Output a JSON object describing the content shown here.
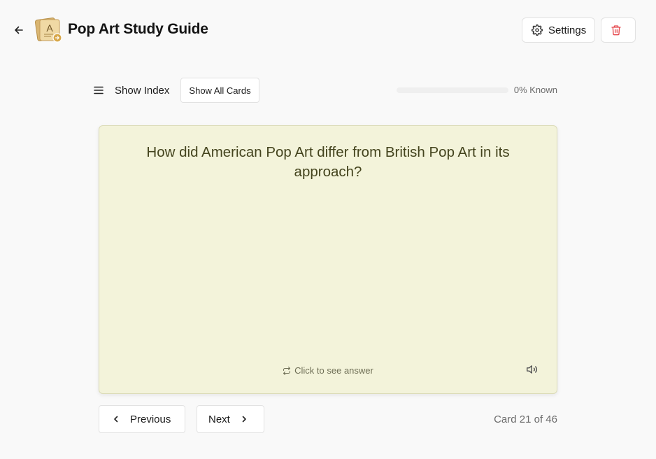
{
  "header": {
    "title": "Pop Art Study Guide",
    "settings_label": "Settings",
    "logo_letter": "A"
  },
  "toolbar": {
    "index_label": "Show Index",
    "show_all_label": "Show All Cards",
    "known_percent": 0,
    "known_label": "0% Known"
  },
  "card": {
    "question": "How did American Pop Art differ from British Pop Art in its approach?",
    "flip_hint": "Click to see answer"
  },
  "navigation": {
    "previous_label": "Previous",
    "next_label": "Next",
    "counter": "Card 21 of 46"
  },
  "colors": {
    "card_bg": "#f3f3da",
    "delete_red": "#e5484d",
    "logo_tan": "#e7c98f"
  },
  "icons": [
    "arrow-left-icon",
    "flashcard-logo-icon",
    "gear-icon",
    "trash-icon",
    "menu-icon",
    "repeat-icon",
    "speaker-icon",
    "chevron-left-icon",
    "chevron-right-icon"
  ]
}
